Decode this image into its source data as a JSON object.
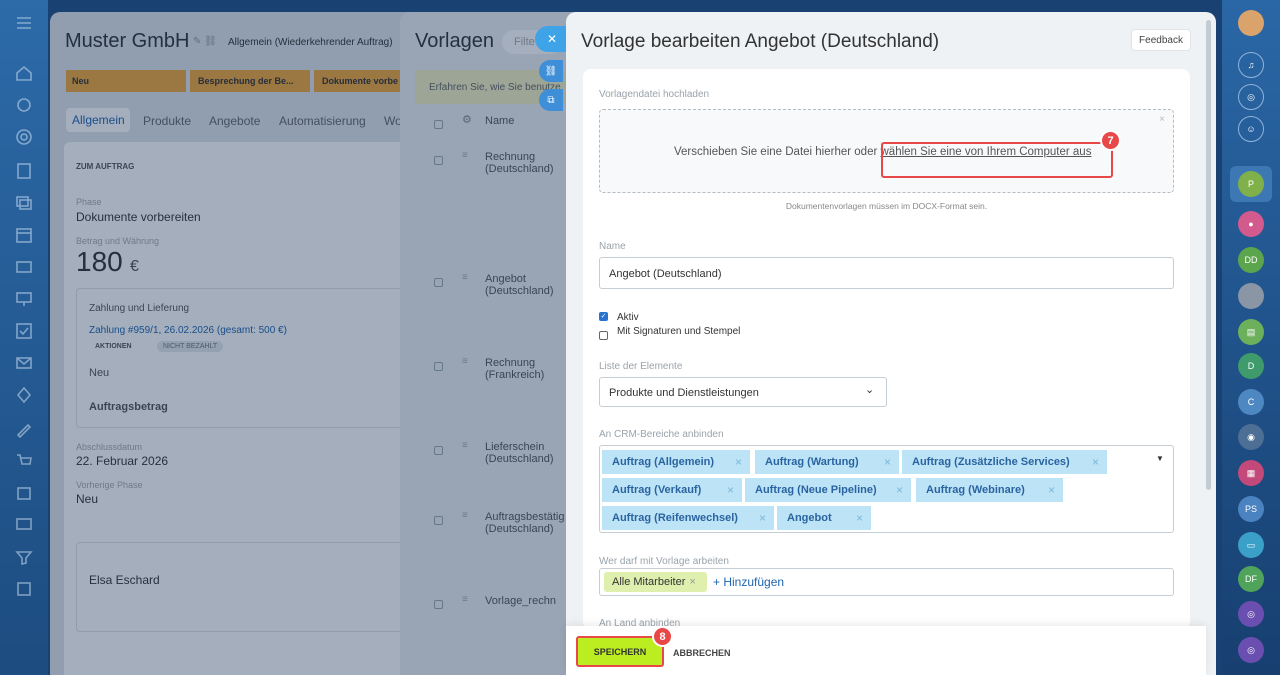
{
  "deal": {
    "title": "Muster GmbH",
    "subtitle": "Allgemein (Wiederkehrender Auftrag)",
    "stages": [
      "Neu",
      "Besprechung der Be...",
      "Dokumente vorbe"
    ],
    "tabs": [
      "Allgemein",
      "Produkte",
      "Angebote",
      "Automatisierung",
      "Wo"
    ],
    "section": "ZUM AUFTRAG",
    "phase_label": "Phase",
    "phase_value": "Dokumente vorbereiten",
    "amount_label": "Betrag und Währung",
    "amount_value": "180",
    "currency": "€",
    "payment_title": "Zahlung und Lieferung",
    "payment_line": "Zahlung #959/1, 26.02.2026 (gesamt: 500 €)",
    "actions": "AKTIONEN",
    "unpaid": "NICHT BEZAHLT",
    "payment_status": "Neu",
    "order_amount": "Auftragsbetrag",
    "close_label": "Abschlussdatum",
    "close_value": "22. Februar 2026",
    "prev_label": "Vorherige Phase",
    "prev_value": "Neu",
    "person_value": "Elsa Eschard"
  },
  "templates": {
    "title": "Vorlagen",
    "filter": "Filte",
    "info": "Erfahren Sie, wie Sie benutze",
    "col_name": "Name",
    "rows": [
      "Rechnung (Deutschland)",
      "Angebot (Deutschland)",
      "Rechnung (Frankreich)",
      "Lieferschein (Deutschland)",
      "Auftragsbestätig (Deutschland)",
      "Vorlage_rechn"
    ]
  },
  "editor": {
    "title": "Vorlage bearbeiten Angebot (Deutschland)",
    "feedback": "Feedback",
    "upload_label": "Vorlagendatei hochladen",
    "drop_text": "Verschieben Sie eine Datei hierher oder ",
    "drop_link": "wählen Sie eine von Ihrem Computer aus",
    "format_hint": "Dokumentenvorlagen müssen im DOCX-Format sein.",
    "name_label": "Name",
    "name_value": "Angebot (Deutschland)",
    "active_label": "Aktiv",
    "signatures_label": "Mit Signaturen und Stempel",
    "elements_label": "Liste der Elemente",
    "elements_value": "Produkte und Dienstleistungen",
    "crm_label": "An CRM-Bereiche anbinden",
    "crm_chips": [
      "Auftrag (Allgemein)",
      "Auftrag (Wartung)",
      "Auftrag (Zusätzliche Services)",
      "Auftrag (Verkauf)",
      "Auftrag (Neue Pipeline)",
      "Auftrag (Webinare)",
      "Auftrag (Reifenwechsel)",
      "Angebot"
    ],
    "access_label": "Wer darf mit Vorlage arbeiten",
    "access_chip": "Alle Mitarbeiter",
    "add_link": "+ Hinzufügen",
    "country_label": "An Land anbinden",
    "save": "SPEICHERN",
    "cancel": "ABBRECHEN",
    "badge_upload": "7",
    "badge_save": "8"
  },
  "rightbar": {
    "avatars": [
      "P",
      "DD",
      "D",
      "C",
      "PS",
      "DF"
    ]
  },
  "colors": {
    "accent": "#2066b0",
    "save": "#bbed21",
    "highlight": "#e84848"
  }
}
